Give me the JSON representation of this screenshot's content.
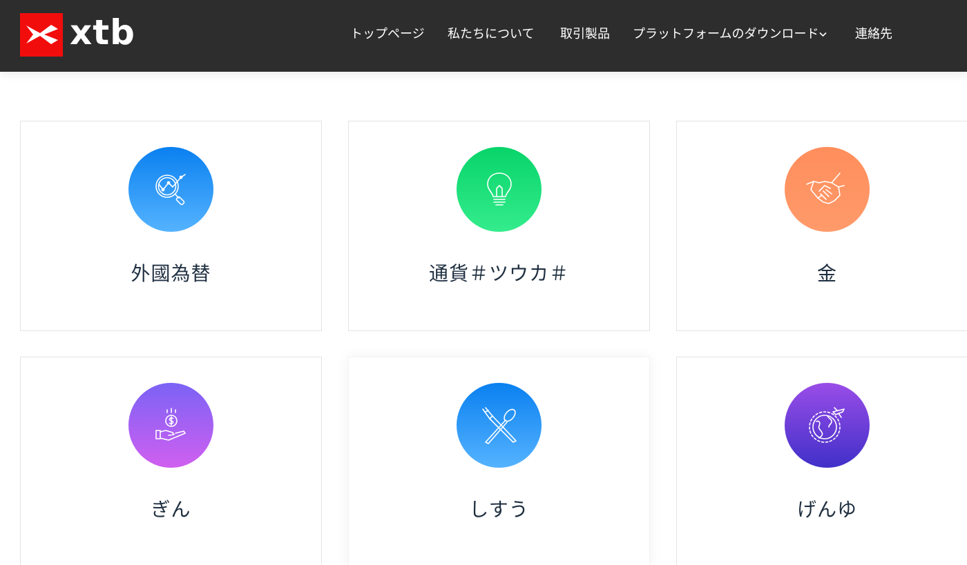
{
  "brand": {
    "name": "xtb",
    "logo_color": "#f20d0d"
  },
  "nav": {
    "items": [
      {
        "label": "トップページ"
      },
      {
        "label": "私たちについて"
      },
      {
        "label": "取引製品"
      },
      {
        "label": "プラットフォームのダウンロード",
        "has_dropdown": true,
        "icon": "chevron-down-icon"
      },
      {
        "label": "連絡先"
      }
    ]
  },
  "cards": [
    {
      "title": "外國為替",
      "icon": "chart-magnifier-icon",
      "gradient": [
        "#0a80f0",
        "#55b3ff"
      ]
    },
    {
      "title": "通貨＃ツウカ＃",
      "icon": "lightbulb-icon",
      "gradient": [
        "#08d46a",
        "#34ec8c"
      ]
    },
    {
      "title": "金",
      "icon": "handshake-icon",
      "gradient": [
        "#ff8e5c",
        "#ff9a6a"
      ]
    },
    {
      "title": "ぎん",
      "icon": "hand-coin-icon",
      "gradient": [
        "#7b63f5",
        "#d05ff0"
      ]
    },
    {
      "title": "しすう",
      "icon": "fork-spoon-icon",
      "gradient": [
        "#0a80f0",
        "#55b3ff"
      ]
    },
    {
      "title": "げんゆ",
      "icon": "globe-plane-icon",
      "gradient": [
        "#9a4de8",
        "#4030c8"
      ]
    }
  ],
  "colors": {
    "header_bg": "#2d2d2d",
    "title_text": "#1f2f40",
    "card_border": "#e3e3e3"
  }
}
